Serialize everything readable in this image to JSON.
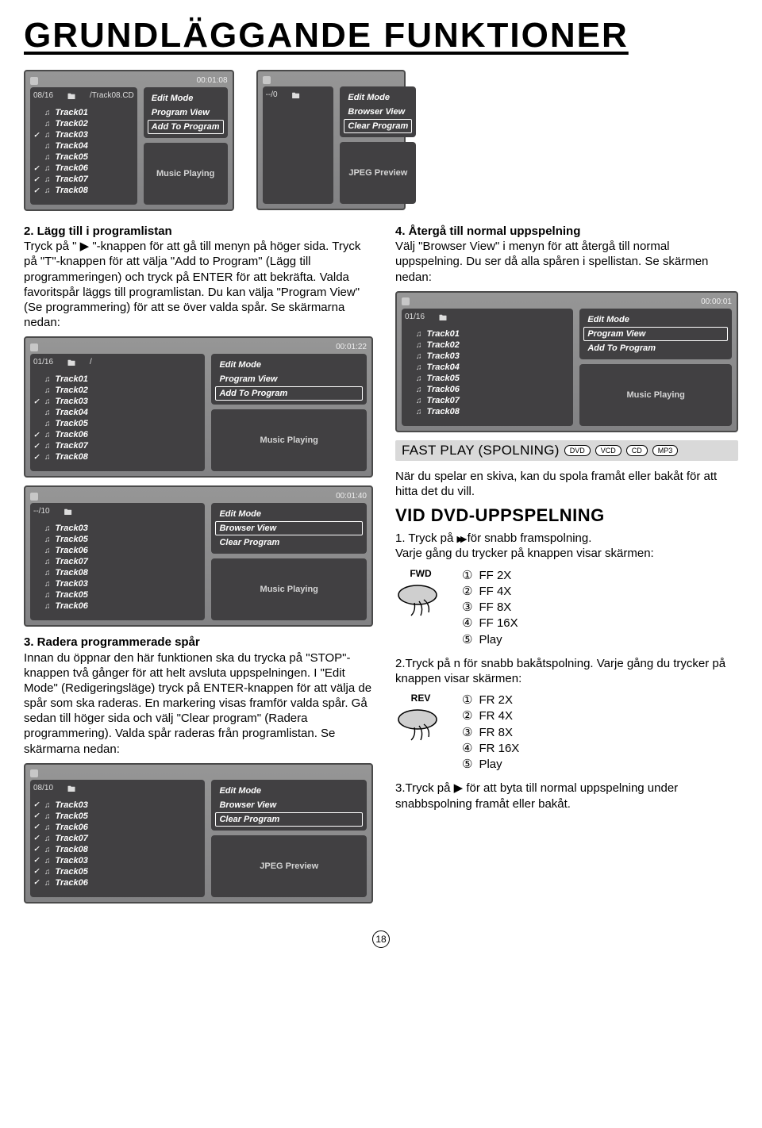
{
  "title": "GRUNDLÄGGANDE FUNKTIONER",
  "pageNumber": "18",
  "left": {
    "sec2_head": "2. Lägg till i programlistan",
    "sec2_body": "Tryck på \" ▶ \"-knappen för att gå till menyn på höger sida. Tryck på \"T\"-knappen för att välja \"Add to Program\" (Lägg till programmeringen) och tryck på ENTER för att bekräfta. Valda favoritspår läggs till programlistan. Du kan välja \"Program View\" (Se programmering) för att se över valda spår. Se skärmarna nedan:",
    "sec3_head": "3. Radera programmerade spår",
    "sec3_body": "Innan du öppnar den här funktionen ska du trycka på \"STOP\"-knappen två gånger för att helt avsluta uppspelningen. I \"Edit Mode\" (Redigeringsläge) tryck på ENTER-knappen för att välja de spår som ska raderas. En markering visas framför valda spår. Gå sedan till höger sida och välj \"Clear program\" (Radera programmering). Valda spår raderas från programlistan. Se skärmarna nedan:"
  },
  "right": {
    "sec4_head": "4. Återgå till normal uppspelning",
    "sec4_body": "Välj \"Browser View\" i menyn för att återgå till normal uppspelning. Du ser då alla spåren i spellistan. Se skärmen nedan:",
    "fastplay_title": "FAST PLAY (SPOLNING)",
    "badges": [
      "DVD",
      "VCD",
      "CD",
      "MP3"
    ],
    "fastplay_intro": "När du spelar en skiva, kan du spola framåt eller bakåt för att hitta det du vill.",
    "vid_h": "VID DVD-UPPSPELNING",
    "step1": "1. Tryck på  för snabb framspolning.",
    "step1b": "Varje gång du trycker på knappen visar skärmen:",
    "fwd_label": "FWD",
    "fwd_list": [
      {
        "n": "①",
        "t": "FF  2X"
      },
      {
        "n": "②",
        "t": "FF  4X"
      },
      {
        "n": "③",
        "t": "FF  8X"
      },
      {
        "n": "④",
        "t": "FF  16X"
      },
      {
        "n": "⑤",
        "t": "Play"
      }
    ],
    "step2": "2.Tryck på n för snabb bakåtspolning. Varje gång du trycker på knappen visar skärmen:",
    "rev_label": "REV",
    "rev_list": [
      {
        "n": "①",
        "t": "FR  2X"
      },
      {
        "n": "②",
        "t": "FR  4X"
      },
      {
        "n": "③",
        "t": "FR  8X"
      },
      {
        "n": "④",
        "t": "FR  16X"
      },
      {
        "n": "⑤",
        "t": "Play"
      }
    ],
    "step3": "3.Tryck på  ▶  för att byta till normal uppspelning under snabbspolning framåt eller bakåt."
  },
  "panels": {
    "p1": {
      "hdr_left": "08/16",
      "hdr_right": "/Track08.CD",
      "time": "00:01:08",
      "tracks": [
        [
          "",
          "Track01"
        ],
        [
          "",
          "Track02"
        ],
        [
          "✓",
          "Track03"
        ],
        [
          "",
          "Track04"
        ],
        [
          "",
          "Track05"
        ],
        [
          "✓",
          "Track06"
        ],
        [
          "✓",
          "Track07"
        ],
        [
          "✓",
          "Track08"
        ]
      ],
      "menu": [
        "Edit Mode",
        "Program View",
        "Add To Program"
      ],
      "menu_sel": 2,
      "preview": "Music Playing"
    },
    "p2": {
      "hdr_left": "--/0",
      "hdr_right": "",
      "time": "",
      "tracks": [],
      "menu": [
        "Edit Mode",
        "Browser View",
        "Clear Program"
      ],
      "menu_sel": 2,
      "preview": "JPEG Preview"
    },
    "p3": {
      "hdr_left": "01/16",
      "hdr_right": "/",
      "time": "00:01:22",
      "tracks": [
        [
          "",
          "Track01"
        ],
        [
          "",
          "Track02"
        ],
        [
          "✓",
          "Track03"
        ],
        [
          "",
          "Track04"
        ],
        [
          "",
          "Track05"
        ],
        [
          "✓",
          "Track06"
        ],
        [
          "✓",
          "Track07"
        ],
        [
          "✓",
          "Track08"
        ]
      ],
      "menu": [
        "Edit Mode",
        "Program View",
        "Add To Program"
      ],
      "menu_sel": 2,
      "preview": "Music Playing"
    },
    "p4": {
      "hdr_left": "--/10",
      "hdr_right": "",
      "time": "00:01:40",
      "tracks": [
        [
          "",
          "Track03"
        ],
        [
          "",
          "Track05"
        ],
        [
          "",
          "Track06"
        ],
        [
          "",
          "Track07"
        ],
        [
          "",
          "Track08"
        ],
        [
          "",
          "Track03"
        ],
        [
          "",
          "Track05"
        ],
        [
          "",
          "Track06"
        ]
      ],
      "menu": [
        "Edit Mode",
        "Browser View",
        "Clear Program"
      ],
      "menu_sel": 1,
      "preview": "Music Playing"
    },
    "p5": {
      "hdr_left": "01/16",
      "hdr_right": "",
      "time": "00:00:01",
      "tracks": [
        [
          "",
          "Track01"
        ],
        [
          "",
          "Track02"
        ],
        [
          "",
          "Track03"
        ],
        [
          "",
          "Track04"
        ],
        [
          "",
          "Track05"
        ],
        [
          "",
          "Track06"
        ],
        [
          "",
          "Track07"
        ],
        [
          "",
          "Track08"
        ]
      ],
      "menu": [
        "Edit Mode",
        "Program View",
        "Add To Program"
      ],
      "menu_sel": 1,
      "preview": "Music Playing"
    },
    "p6": {
      "hdr_left": "08/10",
      "hdr_right": "",
      "time": "",
      "tracks": [
        [
          "✓",
          "Track03"
        ],
        [
          "✓",
          "Track05"
        ],
        [
          "✓",
          "Track06"
        ],
        [
          "✓",
          "Track07"
        ],
        [
          "✓",
          "Track08"
        ],
        [
          "✓",
          "Track03"
        ],
        [
          "✓",
          "Track05"
        ],
        [
          "✓",
          "Track06"
        ]
      ],
      "menu": [
        "Edit Mode",
        "Browser View",
        "Clear Program"
      ],
      "menu_sel": 2,
      "preview": "JPEG Preview"
    }
  }
}
